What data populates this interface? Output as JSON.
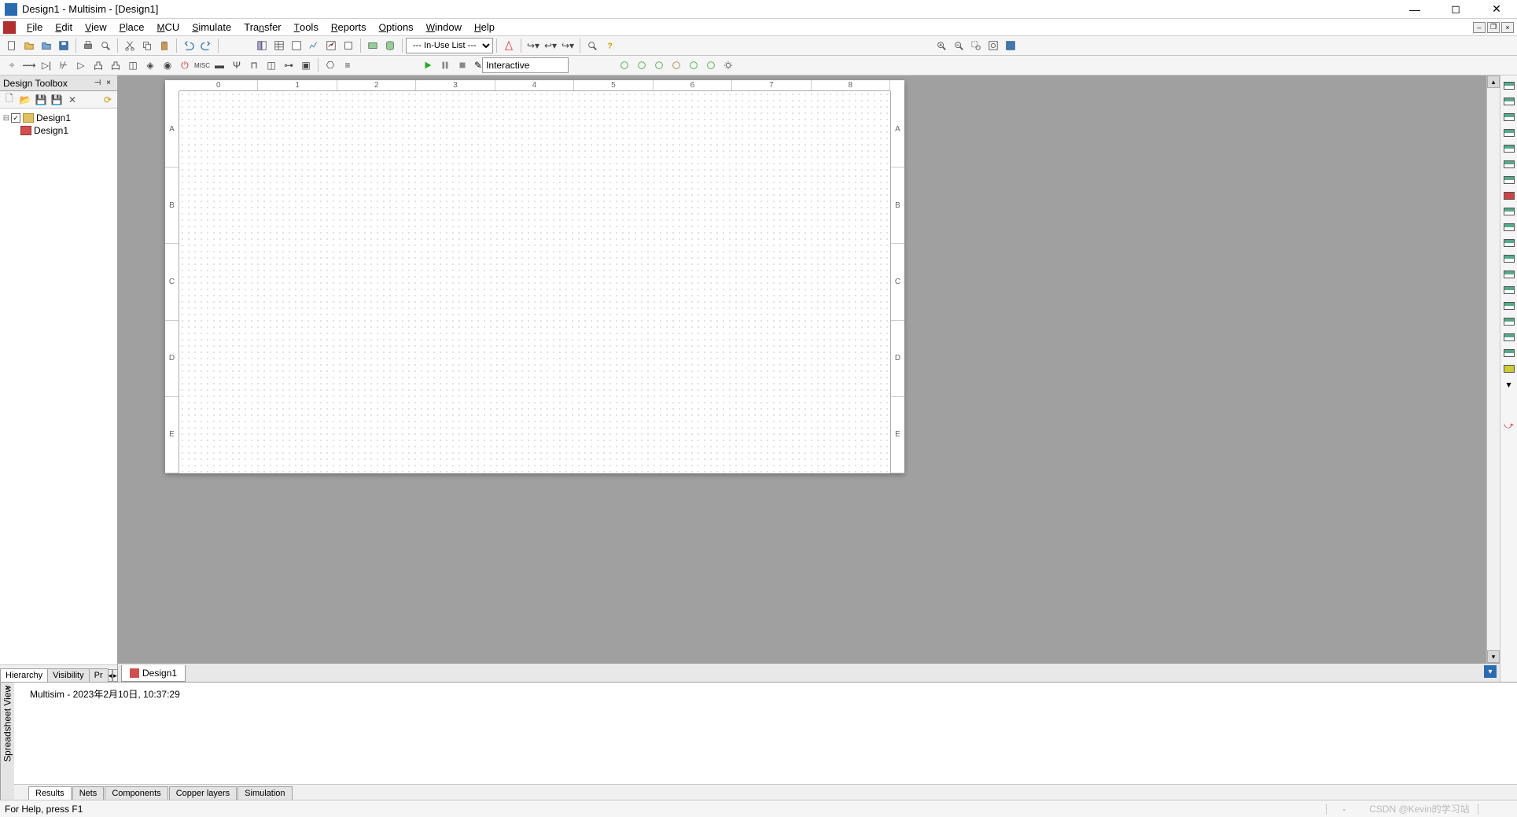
{
  "titlebar": {
    "title": "Design1 - Multisim - [Design1]"
  },
  "menubar": {
    "items": [
      {
        "label": "File",
        "access": "F"
      },
      {
        "label": "Edit",
        "access": "E"
      },
      {
        "label": "View",
        "access": "V"
      },
      {
        "label": "Place",
        "access": "P"
      },
      {
        "label": "MCU",
        "access": "M"
      },
      {
        "label": "Simulate",
        "access": "S"
      },
      {
        "label": "Transfer",
        "access": "T"
      },
      {
        "label": "Tools",
        "access": "T"
      },
      {
        "label": "Reports",
        "access": "R"
      },
      {
        "label": "Options",
        "access": "O"
      },
      {
        "label": "Window",
        "access": "W"
      },
      {
        "label": "Help",
        "access": "H"
      }
    ]
  },
  "toolbar1": {
    "inuse_list": "--- In-Use List ---"
  },
  "toolbar2": {
    "sim_mode": "Interactive"
  },
  "design_toolbox": {
    "title": "Design Toolbox",
    "root": "Design1",
    "child": "Design1",
    "tabs": {
      "hierarchy": "Hierarchy",
      "visibility": "Visibility",
      "pr": "Pr"
    }
  },
  "canvas": {
    "h_ticks": [
      "0",
      "1",
      "2",
      "3",
      "4",
      "5",
      "6",
      "7",
      "8"
    ],
    "v_ticks": [
      "A",
      "B",
      "C",
      "D",
      "E"
    ],
    "doc_tab": "Design1"
  },
  "spreadsheet": {
    "label": "Spreadsheet View",
    "message": "Multisim  -  2023年2月10日, 10:37:29",
    "tabs": {
      "results": "Results",
      "nets": "Nets",
      "components": "Components",
      "copper": "Copper layers",
      "simulation": "Simulation"
    }
  },
  "statusbar": {
    "help": "For Help, press F1",
    "dash": "-",
    "watermark": "CSDN @Kevin的学习站"
  }
}
